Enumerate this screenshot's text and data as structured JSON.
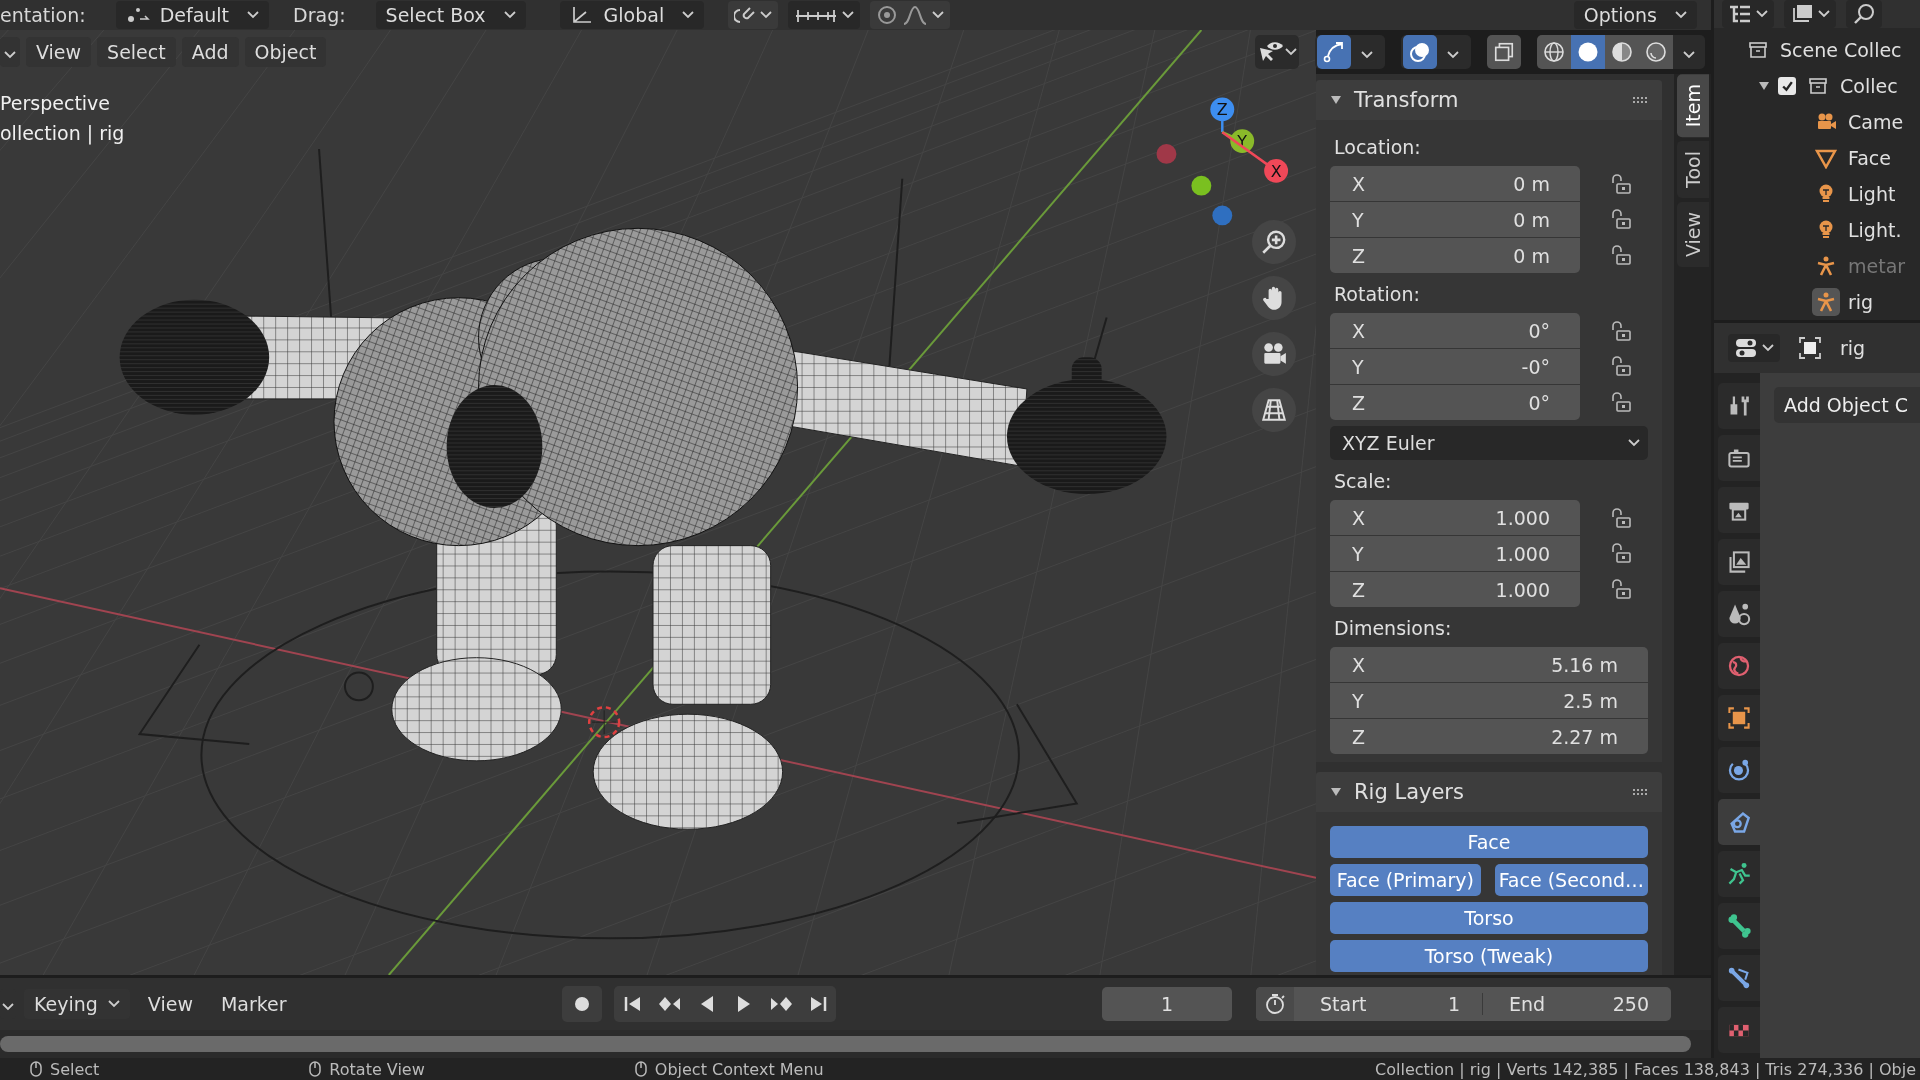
{
  "top_header": {
    "items": [
      {
        "kind": "label",
        "text": "entation:"
      },
      {
        "kind": "icon_dropdown",
        "text": "Default"
      },
      {
        "kind": "label",
        "text": "Drag:"
      },
      {
        "kind": "dropdown",
        "text": "Select Box"
      },
      {
        "kind": "icon_dropdown",
        "text": "Global"
      }
    ],
    "snap_toggle": {
      "on": false
    },
    "proportional_edit": {
      "on": false
    },
    "options": "Options"
  },
  "viewport": {
    "menus": [
      "View",
      "Select",
      "Add",
      "Object"
    ],
    "overlay_text": [
      "Perspective",
      "ollection | rig"
    ],
    "gizmo_toggle": {
      "on": true
    },
    "overlay_toggle": {
      "on": true
    },
    "shading_modes": [
      {
        "selected": false
      },
      {
        "selected": true
      },
      {
        "selected": false
      },
      {
        "selected": false
      }
    ],
    "axes": [
      "Z",
      "Y",
      "X"
    ]
  },
  "sidebar": {
    "tabs": [
      {
        "label": "Item",
        "selected": true
      },
      {
        "label": "Tool",
        "selected": false
      },
      {
        "label": "View",
        "selected": false
      }
    ],
    "transform": {
      "title": "Transform",
      "expanded": true,
      "rows": [
        {
          "kind": "label",
          "text": "Location:"
        },
        {
          "kind": "vector",
          "fields": [
            {
              "axis": "X",
              "value": "0 m",
              "locked": false
            },
            {
              "axis": "Y",
              "value": "0 m",
              "locked": false
            },
            {
              "axis": "Z",
              "value": "0 m",
              "locked": false
            }
          ]
        },
        {
          "kind": "label",
          "text": "Rotation:"
        },
        {
          "kind": "vector",
          "fields": [
            {
              "axis": "X",
              "value": "0°",
              "locked": false
            },
            {
              "axis": "Y",
              "value": "-0°",
              "locked": false
            },
            {
              "axis": "Z",
              "value": "0°",
              "locked": false
            }
          ]
        },
        {
          "kind": "dropdown",
          "text": "XYZ Euler"
        },
        {
          "kind": "label",
          "text": "Scale:"
        },
        {
          "kind": "vector",
          "fields": [
            {
              "axis": "X",
              "value": "1.000",
              "locked": false
            },
            {
              "axis": "Y",
              "value": "1.000",
              "locked": false
            },
            {
              "axis": "Z",
              "value": "1.000",
              "locked": false
            }
          ]
        },
        {
          "kind": "label",
          "text": "Dimensions:"
        },
        {
          "kind": "vector_wide",
          "fields": [
            {
              "axis": "X",
              "value": "5.16 m"
            },
            {
              "axis": "Y",
              "value": "2.5 m"
            },
            {
              "axis": "Z",
              "value": "2.27 m"
            }
          ]
        }
      ]
    },
    "rig_layers": {
      "title": "Rig Layers",
      "expanded": true,
      "rows": [
        [
          {
            "label": "Face",
            "on": true
          }
        ],
        [
          {
            "label": "Face (Primary)",
            "on": true
          },
          {
            "label": "Face (Second…",
            "on": true
          }
        ],
        [
          {
            "label": "Torso",
            "on": true
          }
        ],
        [
          {
            "label": "Torso (Tweak)",
            "on": true
          }
        ]
      ]
    }
  },
  "outliner": {
    "items": [
      {
        "kind": "scene_collection",
        "label": "Scene Collec",
        "children": [
          {
            "kind": "collection",
            "label": "Collec",
            "expanded": true,
            "checked": true,
            "children": [
              {
                "kind": "camera",
                "label": "Came",
                "disabled": false,
                "selected": false
              },
              {
                "kind": "mesh",
                "label": "Face",
                "disabled": false,
                "selected": false
              },
              {
                "kind": "light",
                "label": "Light",
                "disabled": false,
                "selected": false
              },
              {
                "kind": "light",
                "label": "Light.",
                "disabled": false,
                "selected": false
              },
              {
                "kind": "armature",
                "label": "metar",
                "disabled": true,
                "selected": false
              },
              {
                "kind": "armature",
                "label": "rig",
                "disabled": false,
                "selected": true
              }
            ]
          }
        ]
      }
    ]
  },
  "properties": {
    "object_name": "rig",
    "add_button": "Add Object C",
    "tabs": [
      {
        "kind": "tool",
        "selected": false
      },
      {
        "kind": "render",
        "selected": false
      },
      {
        "kind": "output",
        "selected": false
      },
      {
        "kind": "view_layer",
        "selected": false
      },
      {
        "kind": "scene",
        "selected": false
      },
      {
        "kind": "world",
        "selected": false
      },
      {
        "kind": "object",
        "selected": false
      },
      {
        "kind": "physics",
        "selected": false
      },
      {
        "kind": "constraints",
        "selected": true
      },
      {
        "kind": "data",
        "selected": false
      },
      {
        "kind": "bone",
        "selected": false
      },
      {
        "kind": "bone_constraints",
        "selected": false
      },
      {
        "kind": "texture",
        "selected": false
      }
    ]
  },
  "timeline": {
    "menus": [
      {
        "kind": "dropdown",
        "text": "Keying"
      },
      {
        "kind": "menu",
        "text": "View"
      },
      {
        "kind": "menu",
        "text": "Marker"
      }
    ],
    "current_frame": "1",
    "start_label": "Start",
    "start": "1",
    "end_label": "End",
    "end": "250"
  },
  "status_bar": {
    "items": [
      "Select",
      "Rotate View",
      "Object Context Menu"
    ],
    "stats": "Collection | rig | Verts 142,385 | Faces 138,843 | Tris 274,336 | Obje"
  }
}
